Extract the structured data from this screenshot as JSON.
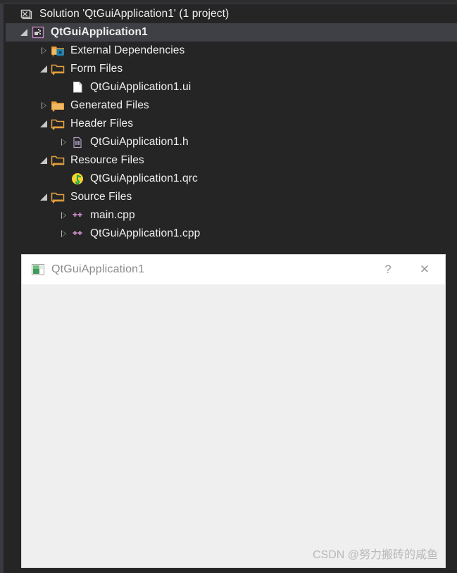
{
  "solution_explorer": {
    "rows": [
      {
        "label": "Solution 'QtGuiApplication1' (1 project)",
        "icon": "solution-icon",
        "twisty": "none",
        "indent": 0,
        "selected": false,
        "bold": false
      },
      {
        "label": "QtGuiApplication1",
        "icon": "project-icon",
        "twisty": "expanded",
        "indent": 1,
        "selected": true,
        "bold": true
      },
      {
        "label": "External Dependencies",
        "icon": "external-dependencies-folder-icon",
        "twisty": "collapsed",
        "indent": 2,
        "selected": false,
        "bold": false
      },
      {
        "label": "Form Files",
        "icon": "filter-folder-icon",
        "twisty": "expanded",
        "indent": 2,
        "selected": false,
        "bold": false
      },
      {
        "label": "QtGuiApplication1.ui",
        "icon": "ui-file-icon",
        "twisty": "none",
        "indent": 3,
        "selected": false,
        "bold": false
      },
      {
        "label": "Generated Files",
        "icon": "folder-icon",
        "twisty": "collapsed",
        "indent": 2,
        "selected": false,
        "bold": false
      },
      {
        "label": "Header Files",
        "icon": "filter-folder-icon",
        "twisty": "expanded",
        "indent": 2,
        "selected": false,
        "bold": false
      },
      {
        "label": "QtGuiApplication1.h",
        "icon": "header-file-icon",
        "twisty": "collapsed",
        "indent": 3,
        "selected": false,
        "bold": false
      },
      {
        "label": "Resource Files",
        "icon": "filter-folder-icon",
        "twisty": "expanded",
        "indent": 2,
        "selected": false,
        "bold": false
      },
      {
        "label": "QtGuiApplication1.qrc",
        "icon": "qrc-file-icon",
        "twisty": "none",
        "indent": 3,
        "selected": false,
        "bold": false
      },
      {
        "label": "Source Files",
        "icon": "filter-folder-icon",
        "twisty": "expanded",
        "indent": 2,
        "selected": false,
        "bold": false
      },
      {
        "label": "main.cpp",
        "icon": "cpp-file-icon",
        "twisty": "collapsed",
        "indent": 3,
        "selected": false,
        "bold": false
      },
      {
        "label": "QtGuiApplication1.cpp",
        "icon": "cpp-file-icon",
        "twisty": "collapsed",
        "indent": 3,
        "selected": false,
        "bold": false
      }
    ]
  },
  "qt_window": {
    "title": "QtGuiApplication1",
    "app_icon": "qt-app-icon",
    "help_button": "?",
    "close_button": "✕",
    "client_background": "#efefef",
    "titlebar_background": "#ffffff"
  },
  "watermark": {
    "text": "CSDN @努力搬砖的咸鱼"
  },
  "colors": {
    "tree_background": "#252526",
    "selected_row": "#3f3f46",
    "text": "#f0f0f0",
    "folder_orange": "#e8a33d",
    "cpp_purple": "#c586c0",
    "qrc_yellow": "#f6d32d"
  }
}
